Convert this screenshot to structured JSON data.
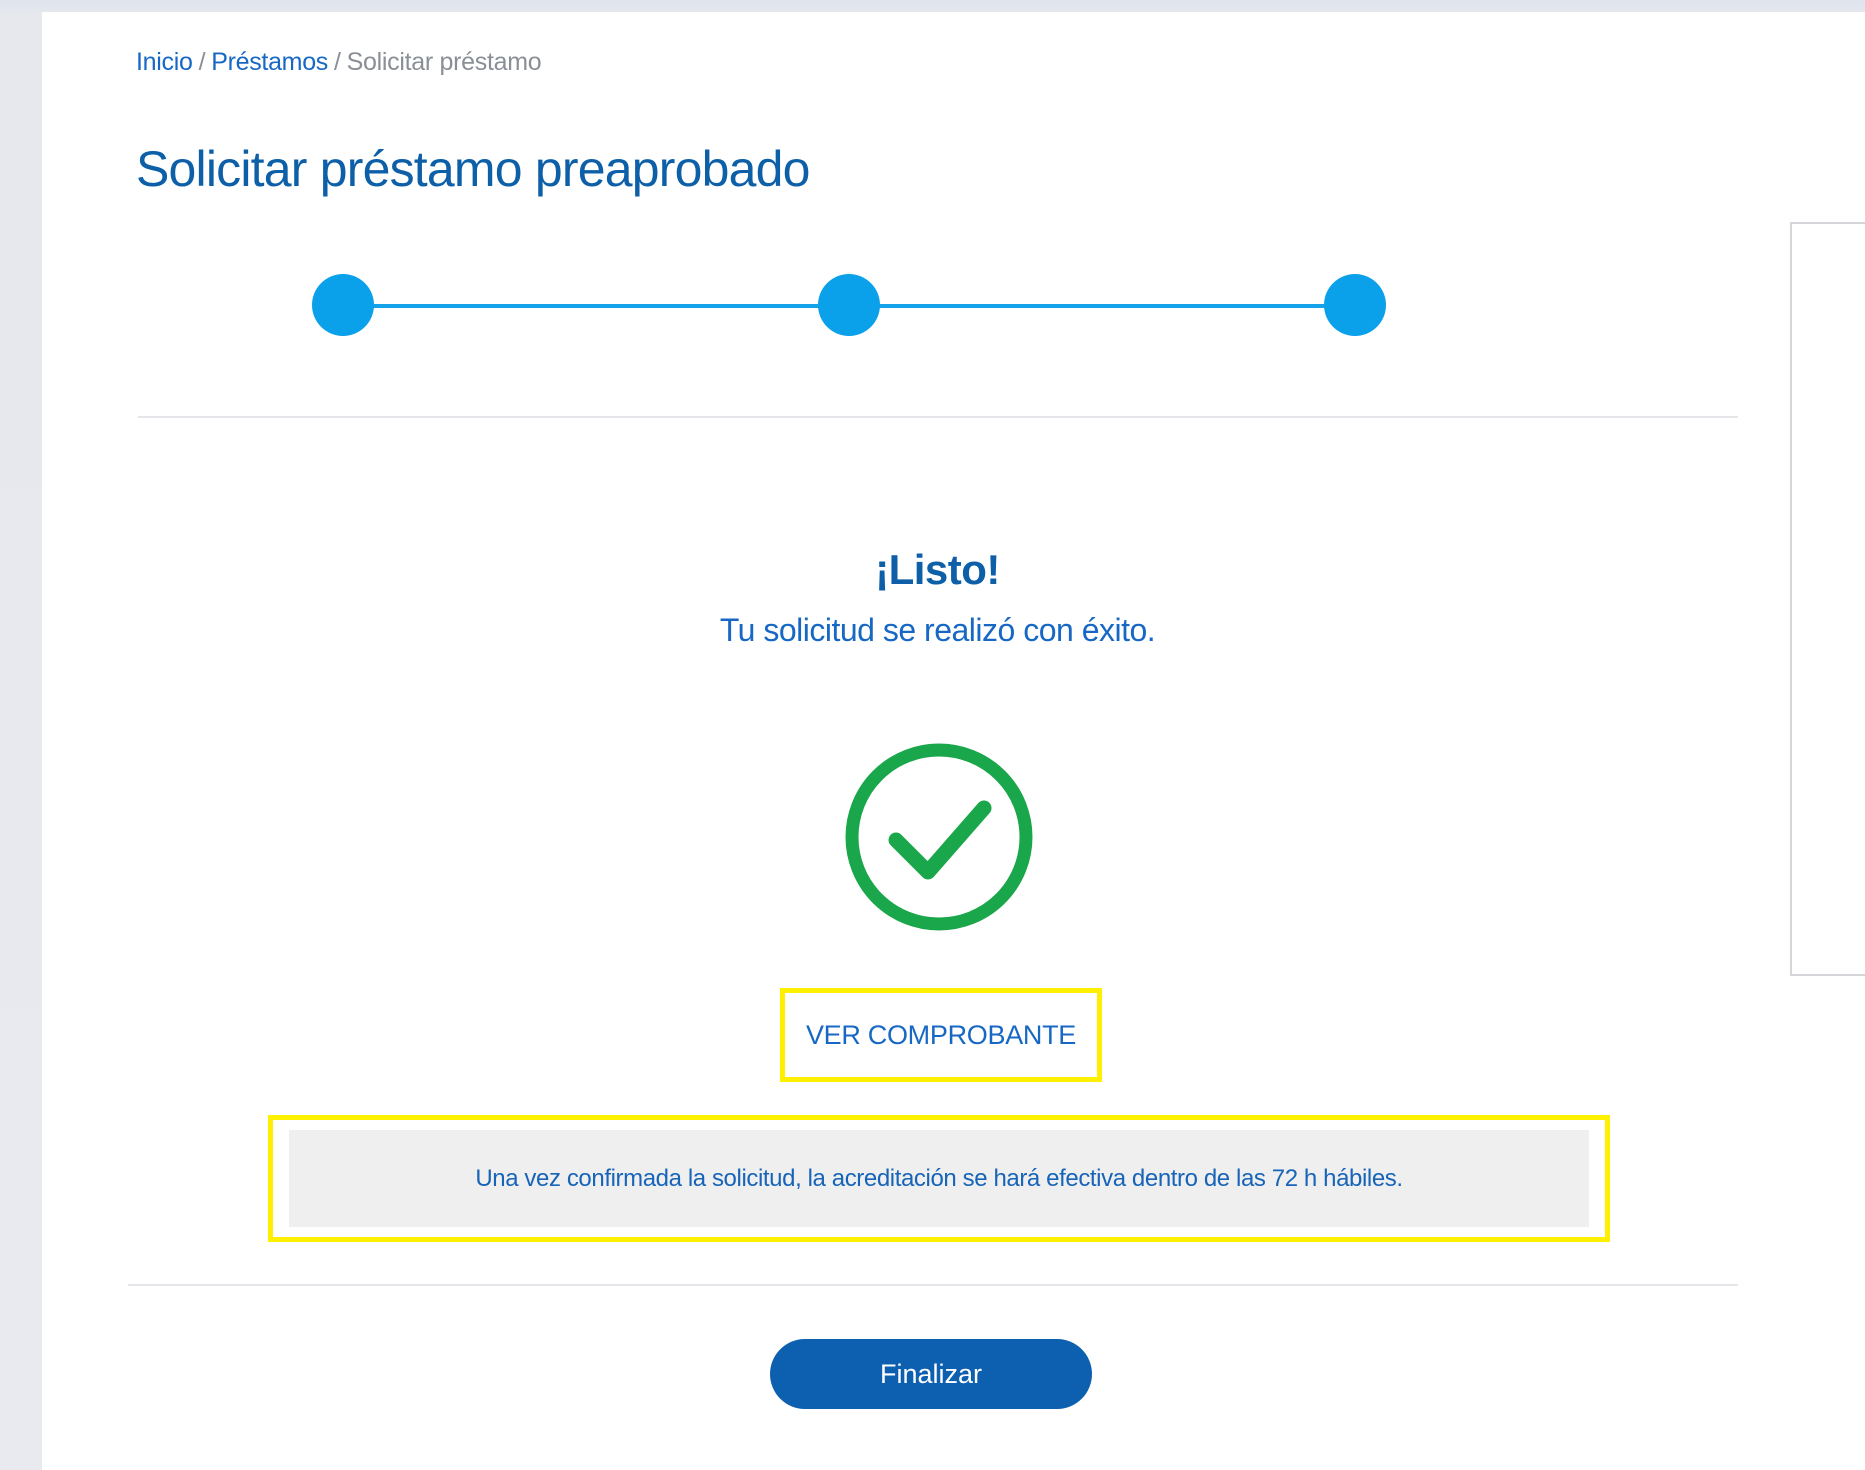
{
  "breadcrumb": {
    "items": [
      {
        "label": "Inicio",
        "link": true
      },
      {
        "label": "Préstamos",
        "link": true
      },
      {
        "label": "Solicitar préstamo",
        "link": false
      }
    ],
    "separator": "/"
  },
  "page_title": "Solicitar préstamo preaprobado",
  "stepper": {
    "total_steps": 3,
    "current_step": 3,
    "active_color": "#0ba0ea"
  },
  "success": {
    "title": "¡Listo!",
    "subtitle": "Tu solicitud se realizó con éxito.",
    "icon": "check-circle-icon",
    "icon_color": "#1aa64a"
  },
  "actions": {
    "ver_comprobante_label": "VER COMPROBANTE",
    "finalizar_label": "Finalizar"
  },
  "info_message": "Una vez confirmada la solicitud, la acreditación se hará efectiva dentro de las 72 h hábiles.",
  "colors": {
    "primary": "#0d5fa8",
    "link": "#1768c4",
    "highlight": "#fff000"
  }
}
